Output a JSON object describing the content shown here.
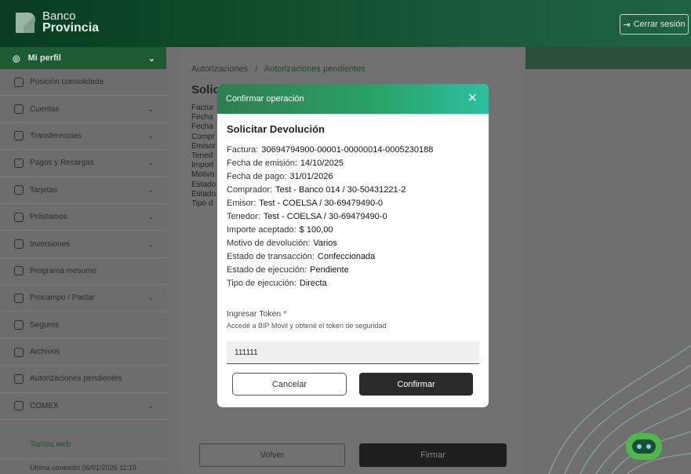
{
  "header": {
    "logo_line1": "Banco",
    "logo_line2": "Provincia",
    "logout_label": "Cerrar sesión",
    "logout_icon": "logout-icon"
  },
  "sidebar": {
    "profile_label": "Mi perfil",
    "items": [
      {
        "label": "Posición consolidada",
        "icon": "home-icon",
        "has_chevron": false
      },
      {
        "label": "Cuentas",
        "icon": "wallet-icon",
        "has_chevron": true
      },
      {
        "label": "Transferencias",
        "icon": "transfer-icon",
        "has_chevron": true
      },
      {
        "label": "Pagos y Recargas",
        "icon": "payments-icon",
        "has_chevron": true
      },
      {
        "label": "Tarjetas",
        "icon": "card-icon",
        "has_chevron": true
      },
      {
        "label": "Préstamos",
        "icon": "loan-icon",
        "has_chevron": true
      },
      {
        "label": "Inversiones",
        "icon": "chart-icon",
        "has_chevron": true
      },
      {
        "label": "Programa mesumo",
        "icon": "program-icon",
        "has_chevron": false
      },
      {
        "label": "Procampo / Pactar",
        "icon": "field-icon",
        "has_chevron": true
      },
      {
        "label": "Seguros",
        "icon": "shield-icon",
        "has_chevron": false
      },
      {
        "label": "Archivos",
        "icon": "folder-icon",
        "has_chevron": false
      },
      {
        "label": "Autorizaciones pendientes",
        "icon": "authorization-icon",
        "has_chevron": false
      },
      {
        "label": "COMEX",
        "icon": "globe-icon",
        "has_chevron": true
      }
    ],
    "turnos_label": "Turnos web",
    "last_connection": "Última conexión 06/01/2026 11:19"
  },
  "background_page": {
    "breadcrumb_root": "Autorizaciones",
    "breadcrumb_sep": "/",
    "breadcrumb_current": "Autorizaciones pendientes",
    "title": "Solic",
    "lines": [
      "Factur",
      "Fecha",
      "Fecha",
      "Compr",
      "Emisor",
      "Tened",
      "Import",
      "Motivo",
      "Estado",
      "Estado",
      "Tipo d"
    ],
    "back_button": "Volver",
    "sign_button": "Firmar"
  },
  "modal": {
    "header_title": "Confirmar operación",
    "close_glyph": "✕",
    "title": "Solicitar Devolución",
    "details": [
      {
        "label": "Factura:",
        "value": "30694794900-00001-00000014-0005230188"
      },
      {
        "label": "Fecha de emisión:",
        "value": "14/10/2025"
      },
      {
        "label": "Fecha de pago:",
        "value": "31/01/2026"
      },
      {
        "label": "Comprador:",
        "value": "Test - Banco 014 / 30-50431221-2"
      },
      {
        "label": "Emisor:",
        "value": "Test - COELSA / 30-69479490-0"
      },
      {
        "label": "Tenedor:",
        "value": "Test - COELSA / 30-69479490-0"
      },
      {
        "label": "Importe aceptado:",
        "value": "$ 100,00"
      },
      {
        "label": "Motivo de devolución:",
        "value": "Varios"
      },
      {
        "label": "Estado de transacción:",
        "value": "Confeccionada"
      },
      {
        "label": "Estado de ejecución:",
        "value": "Pendiente"
      },
      {
        "label": "Tipo de ejecución:",
        "value": "Directa"
      }
    ],
    "token_label": "Ingresar Token",
    "token_required": "*",
    "token_help": "Accedé a BIP Móvil y obtené el token de seguridad",
    "token_value": "111111",
    "cancel_label": "Cancelar",
    "confirm_label": "Confirmar"
  },
  "colors": {
    "brand_green": "#2aa36a",
    "brand_teal": "#2bbfa0",
    "required_red": "#d9262c",
    "dark_button": "#2b2b2b"
  }
}
